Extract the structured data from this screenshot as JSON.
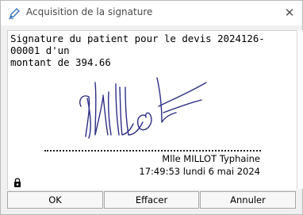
{
  "window": {
    "title": "Acquisition de la signature",
    "icon": "pen-icon",
    "close_icon": "close-icon",
    "close_label": "✕"
  },
  "content": {
    "message": "Signature du patient pour le devis 2024126-00001 d'un\nmontant de 394.66",
    "signature": "handwritten signature",
    "signer_name": "Mlle MILLOT Typhaine",
    "sign_datetime": "17:49:53 lundi 6 mai 2024",
    "lock_icon": "lock-icon"
  },
  "buttons": {
    "ok_label": "OK",
    "clear_label": "Effacer",
    "cancel_label": "Annuler"
  },
  "colors": {
    "signature_ink": "#2e2f86",
    "title_text": "#4a4a4a",
    "dialog_bg": "#f0f0f0"
  }
}
